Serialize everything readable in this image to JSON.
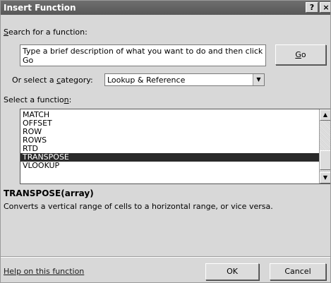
{
  "window": {
    "title": "Insert Function",
    "help_btn": "?",
    "close_btn": "×"
  },
  "search": {
    "label_key": "S",
    "label_rest": "earch for a function:",
    "value": "Type a brief description of what you want to do and then click Go",
    "go_key": "G",
    "go_rest": "o"
  },
  "category": {
    "label_pre": "Or select a ",
    "label_key": "c",
    "label_post": "ategory:",
    "value": "Lookup & Reference"
  },
  "function_list": {
    "label_pre": "Select a functio",
    "label_key": "n",
    "label_post": ":",
    "items": [
      "MATCH",
      "OFFSET",
      "ROW",
      "ROWS",
      "RTD",
      "TRANSPOSE",
      "VLOOKUP"
    ],
    "selected": "TRANSPOSE"
  },
  "selection": {
    "signature": "TRANSPOSE(array)",
    "description": "Converts a vertical range of cells to a horizontal range, or vice versa."
  },
  "footer": {
    "help_link": "Help on this function",
    "ok": "OK",
    "cancel": "Cancel"
  },
  "icons": {
    "dropdown": "▼",
    "scroll_up": "▲",
    "scroll_down": "▼"
  }
}
